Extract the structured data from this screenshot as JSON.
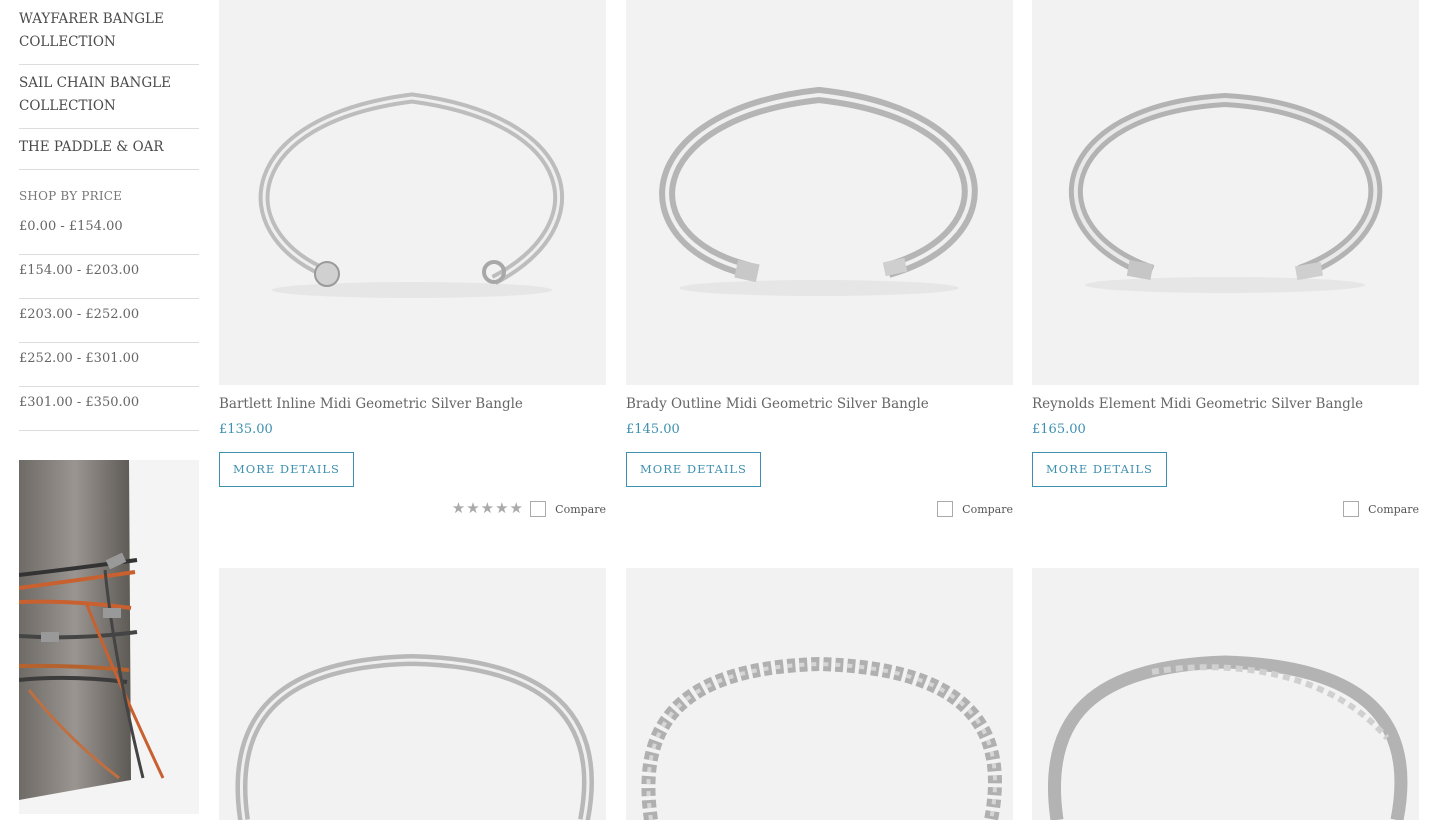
{
  "sidebar": {
    "categories": [
      {
        "label": "WAYFARER BANGLE COLLECTION"
      },
      {
        "label": "SAIL CHAIN BANGLE COLLECTION"
      },
      {
        "label": "THE PADDLE & OAR"
      }
    ],
    "price_heading": "SHOP BY PRICE",
    "price_ranges": [
      {
        "label": "£0.00 - £154.00"
      },
      {
        "label": "£154.00 - £203.00"
      },
      {
        "label": "£203.00 - £252.00"
      },
      {
        "label": "£252.00 - £301.00"
      },
      {
        "label": "£301.00 - £350.00"
      }
    ]
  },
  "products": [
    {
      "name": "Bartlett Inline Midi Geometric Silver Bangle",
      "price": "£135.00",
      "button": "MORE DETAILS",
      "compare": "Compare",
      "rating": "★★★★★"
    },
    {
      "name": "Brady Outline Midi Geometric Silver Bangle",
      "price": "£145.00",
      "button": "MORE DETAILS",
      "compare": "Compare"
    },
    {
      "name": "Reynolds Element Midi Geometric Silver Bangle",
      "price": "£165.00",
      "button": "MORE DETAILS",
      "compare": "Compare"
    }
  ],
  "colors": {
    "accent": "#3e90b0",
    "image_bg": "#f2f2f2",
    "divider": "#dddddd"
  }
}
